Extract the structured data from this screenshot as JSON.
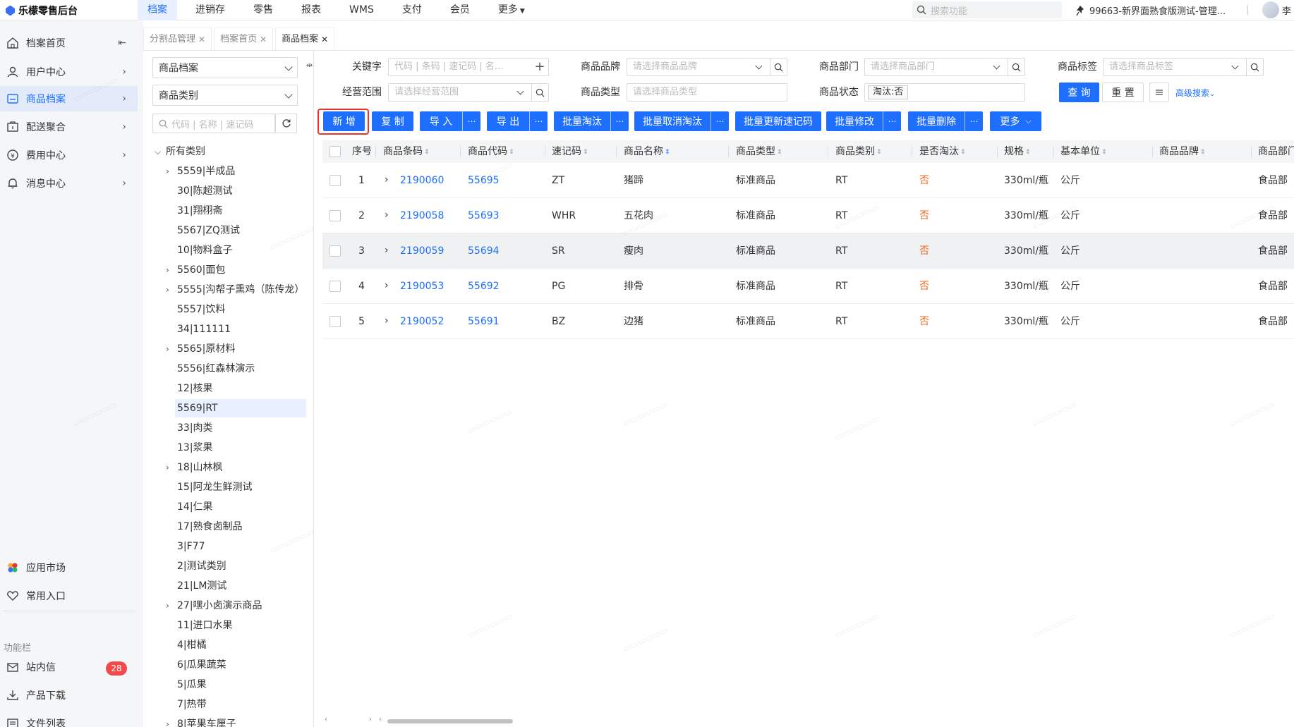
{
  "app": {
    "title": "乐檬零售后台"
  },
  "top_nav": [
    "档案",
    "进销存",
    "零售",
    "报表",
    "WMS",
    "支付",
    "会员",
    "更多"
  ],
  "top_search": {
    "placeholder": "搜索功能"
  },
  "user": {
    "store": "99663-新界面熟食版测试-管理...",
    "name": "李"
  },
  "sidebar": {
    "items": [
      {
        "label": "档案首页"
      },
      {
        "label": "用户中心"
      },
      {
        "label": "商品档案"
      },
      {
        "label": "配送聚合"
      },
      {
        "label": "费用中心"
      },
      {
        "label": "消息中心"
      }
    ],
    "bottom": [
      {
        "label": "应用市场"
      },
      {
        "label": "常用入口"
      }
    ],
    "group_label": "功能栏",
    "tools": [
      {
        "label": "站内信",
        "badge": "28"
      },
      {
        "label": "产品下载"
      },
      {
        "label": "文件列表"
      }
    ]
  },
  "tabs": [
    {
      "label": "分割品管理"
    },
    {
      "label": "档案首页"
    },
    {
      "label": "商品档案"
    }
  ],
  "tree_panel": {
    "select1": "商品档案",
    "select2": "商品类别",
    "search_placeholder": "代码 | 名称 | 速记码",
    "root": "所有类别",
    "nodes": [
      {
        "label": "5559|半成品",
        "caret": true
      },
      {
        "label": "30|陈超测试",
        "caret": false
      },
      {
        "label": "31|翔栩斋",
        "caret": false
      },
      {
        "label": "5567|ZQ测试",
        "caret": false
      },
      {
        "label": "10|物料盒子",
        "caret": false
      },
      {
        "label": "5560|面包",
        "caret": true
      },
      {
        "label": "5555|沟帮子熏鸡（陈传龙）",
        "caret": true
      },
      {
        "label": "5557|饮料",
        "caret": false
      },
      {
        "label": "34|111111",
        "caret": false
      },
      {
        "label": "5565|原材料",
        "caret": true
      },
      {
        "label": "5556|红森林演示",
        "caret": false
      },
      {
        "label": "12|核果",
        "caret": false
      },
      {
        "label": "5569|RT",
        "caret": false,
        "selected": true
      },
      {
        "label": "33|肉类",
        "caret": false
      },
      {
        "label": "13|浆果",
        "caret": false
      },
      {
        "label": "18|山林枫",
        "caret": true
      },
      {
        "label": "15|阿龙生鲜测试",
        "caret": false
      },
      {
        "label": "14|仁果",
        "caret": false
      },
      {
        "label": "17|熟食卤制品",
        "caret": false
      },
      {
        "label": "3|F77",
        "caret": false
      },
      {
        "label": "2|测试类别",
        "caret": false
      },
      {
        "label": "21|LM测试",
        "caret": false
      },
      {
        "label": "27|嘿小卤演示商品",
        "caret": true
      },
      {
        "label": "11|进口水果",
        "caret": false
      },
      {
        "label": "4|柑橘",
        "caret": false
      },
      {
        "label": "6|瓜果蔬菜",
        "caret": false
      },
      {
        "label": "5|瓜果",
        "caret": false
      },
      {
        "label": "7|热带",
        "caret": false
      },
      {
        "label": "8|苹果车厘子",
        "caret": true
      }
    ]
  },
  "filters": {
    "keyword": {
      "label": "关键字",
      "placeholder": "代码 | 条码 | 速记码 | 名..."
    },
    "brand": {
      "label": "商品品牌",
      "placeholder": "请选择商品品牌"
    },
    "dept": {
      "label": "商品部门",
      "placeholder": "请选择商品部门"
    },
    "tag": {
      "label": "商品标签",
      "placeholder": "请选择商品标签"
    },
    "scope": {
      "label": "经营范围",
      "placeholder": "请选择经营范围"
    },
    "type": {
      "label": "商品类型",
      "placeholder": "请选择商品类型"
    },
    "status": {
      "label": "商品状态",
      "value": "淘汰:否"
    },
    "query_btn": "查 询",
    "reset_btn": "重 置",
    "advanced": "高级搜索"
  },
  "actions": [
    {
      "label": "新 增",
      "more": false
    },
    {
      "label": "复 制",
      "more": false
    },
    {
      "label": "导 入",
      "more": true
    },
    {
      "label": "导 出",
      "more": true
    },
    {
      "label": "批量淘汰",
      "more": true
    },
    {
      "label": "批量取消淘汰",
      "more": true
    },
    {
      "label": "批量更新速记码",
      "more": false
    },
    {
      "label": "批量修改",
      "more": true
    },
    {
      "label": "批量删除",
      "more": true
    },
    {
      "label": "更多",
      "more": false,
      "dropdown": true
    }
  ],
  "table": {
    "columns": [
      "序号",
      "商品条码",
      "商品代码",
      "速记码",
      "商品名称",
      "商品类型",
      "商品类别",
      "是否淘汰",
      "规格",
      "基本单位",
      "商品品牌",
      "商品部门"
    ],
    "rows": [
      {
        "no": "1",
        "barcode": "2190060",
        "code": "55695",
        "quick": "ZT",
        "name": "猪蹄",
        "type": "标准商品",
        "category": "RT",
        "obsolete": "否",
        "spec": "330ml/瓶",
        "unit": "公斤",
        "brand": "",
        "dept": "食品部"
      },
      {
        "no": "2",
        "barcode": "2190058",
        "code": "55693",
        "quick": "WHR",
        "name": "五花肉",
        "type": "标准商品",
        "category": "RT",
        "obsolete": "否",
        "spec": "330ml/瓶",
        "unit": "公斤",
        "brand": "",
        "dept": "食品部"
      },
      {
        "no": "3",
        "barcode": "2190059",
        "code": "55694",
        "quick": "SR",
        "name": "瘦肉",
        "type": "标准商品",
        "category": "RT",
        "obsolete": "否",
        "spec": "330ml/瓶",
        "unit": "公斤",
        "brand": "",
        "dept": "食品部"
      },
      {
        "no": "4",
        "barcode": "2190053",
        "code": "55692",
        "quick": "PG",
        "name": "排骨",
        "type": "标准商品",
        "category": "RT",
        "obsolete": "否",
        "spec": "330ml/瓶",
        "unit": "公斤",
        "brand": "",
        "dept": "食品部"
      },
      {
        "no": "5",
        "barcode": "2190052",
        "code": "55691",
        "quick": "BZ",
        "name": "边猪",
        "type": "标准商品",
        "category": "RT",
        "obsolete": "否",
        "spec": "330ml/瓶",
        "unit": "公斤",
        "brand": "",
        "dept": "食品部"
      }
    ]
  },
  "colors": {
    "accent": "#1f6fff",
    "highlight": "#e8332f",
    "warn": "#f06b20"
  }
}
